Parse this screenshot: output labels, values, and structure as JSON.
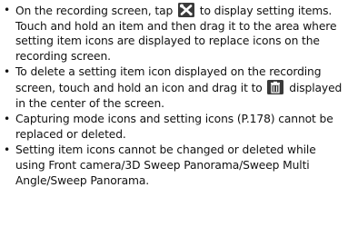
{
  "bullet_symbol": "•",
  "items": [
    {
      "before_icon": "On the recording screen, tap ",
      "icon": "settings-tools-icon",
      "after_icon": " to display setting items. Touch and hold an item and then drag it to the area where setting item icons are displayed to replace icons on the recording screen."
    },
    {
      "before_icon": "To delete a setting item icon displayed on the recording screen, touch and hold an icon and drag it to ",
      "icon": "trash-icon",
      "after_icon": " displayed in the center of the screen."
    },
    {
      "text": "Capturing mode icons and setting icons (P.178) cannot be replaced or deleted."
    },
    {
      "text": "Setting item icons cannot be changed or deleted while using Front camera/3D Sweep Panorama/Sweep Multi Angle/Sweep Panorama."
    }
  ],
  "colors": {
    "text": "#111111",
    "icon_background": "#3a3a3a",
    "icon_foreground": "#ffffff"
  }
}
